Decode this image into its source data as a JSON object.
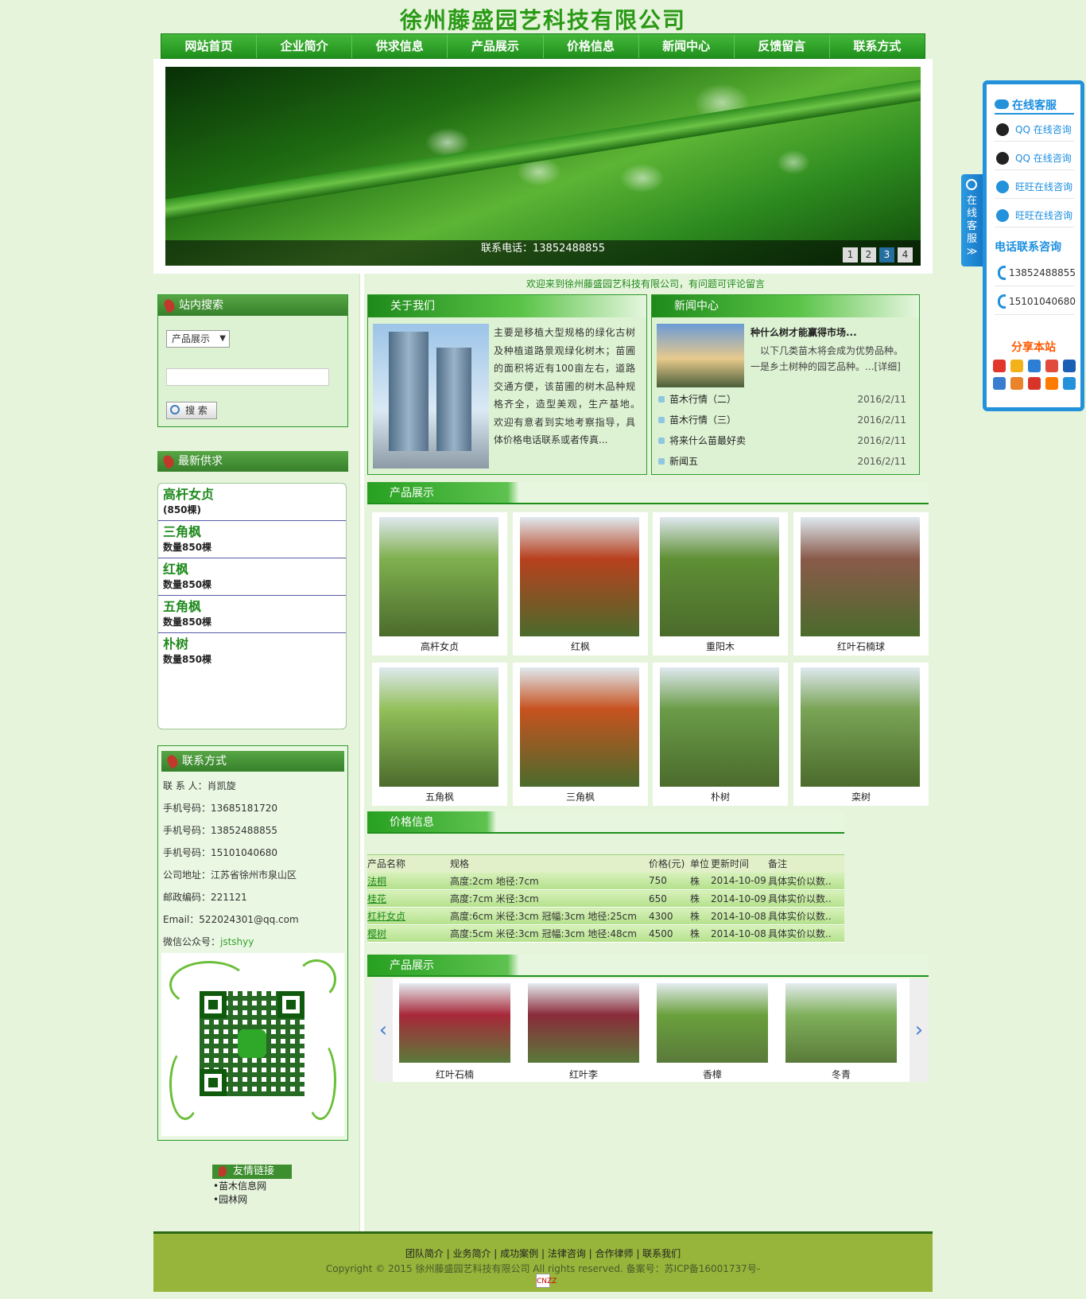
{
  "site": {
    "title": "徐州藤盛园艺科技有限公司"
  },
  "nav": [
    "网站首页",
    "企业简介",
    "供求信息",
    "产品展示",
    "价格信息",
    "新闻中心",
    "反馈留言",
    "联系方式"
  ],
  "banner": {
    "phone": "联系电话：13852488855",
    "dots": [
      "1",
      "2",
      "3",
      "4"
    ],
    "active_dot": 3
  },
  "search": {
    "title": "站内搜索",
    "select_value": "产品展示",
    "button": "搜 索"
  },
  "supply": {
    "title": "最新供求",
    "items": [
      {
        "name": "高杆女贞",
        "qty": "(850棵)"
      },
      {
        "name": "三角枫",
        "qty": "数量850棵"
      },
      {
        "name": "红枫",
        "qty": "数量850棵"
      },
      {
        "name": "五角枫",
        "qty": "数量850棵"
      },
      {
        "name": "朴树",
        "qty": "数量850棵"
      }
    ]
  },
  "contact": {
    "title": "联系方式",
    "rows": [
      "联 系 人：肖凯旋",
      "手机号码：13685181720",
      "手机号码：13852488855",
      "手机号码：15101040680",
      "公司地址：江苏省徐州市泉山区",
      "邮政编码：221121",
      "Email：522024301@qq.com"
    ],
    "wechat_label": "微信公众号：",
    "wechat_id": "jstshyy"
  },
  "links": {
    "title": "友情链接",
    "items": [
      "苗木信息网",
      "园林网"
    ]
  },
  "welcome": "欢迎来到徐州藤盛园艺科技有限公司，有问题可评论留言",
  "about": {
    "title": "关于我们",
    "text": "主要是移植大型规格的绿化古树及种植道路景观绿化树木；苗圃的面积将近有100亩左右，道路交通方便，该苗圃的树木品种规格齐全，造型美观，生产基地。　欢迎有意者到实地考察指导，具体价格电话联系或者传真..."
  },
  "news": {
    "title": "新闻中心",
    "headline": "种什么树才能赢得市场...",
    "desc": "以下几类苗木将会成为优势品种。一是乡土树种的园艺品种。...[详细]",
    "rows": [
      {
        "title": "苗木行情（二）",
        "date": "2016/2/11"
      },
      {
        "title": "苗木行情（三）",
        "date": "2016/2/11"
      },
      {
        "title": "将来什么苗最好卖",
        "date": "2016/2/11"
      },
      {
        "title": "新闻五",
        "date": "2016/2/11"
      }
    ]
  },
  "products": {
    "title": "产品展示",
    "items": [
      "高杆女贞",
      "红枫",
      "重阳木",
      "红叶石楠球",
      "五角枫",
      "三角枫",
      "朴树",
      "栾树"
    ],
    "colors": [
      "#7fb04e",
      "#b8401e",
      "#5f8f35",
      "#8a5a4a",
      "#92c05a",
      "#c7521f",
      "#6a9c48",
      "#7aa456"
    ]
  },
  "prices": {
    "title": "价格信息",
    "headers": [
      "产品名称",
      "规格",
      "价格(元)",
      "单位",
      "更新时间",
      "备注"
    ],
    "rows": [
      [
        "法桐",
        "高度:2cm 地径:7cm",
        "750",
        "株",
        "2014-10-09",
        "具体实价以数.."
      ],
      [
        "桂花",
        "高度:7cm 米径:3cm",
        "650",
        "株",
        "2014-10-09",
        "具体实价以数.."
      ],
      [
        "杠杆女贞",
        "高度:6cm 米径:3cm 冠幅:3cm 地径:25cm",
        "4300",
        "株",
        "2014-10-08",
        "具体实价以数.."
      ],
      [
        "樱树",
        "高度:5cm 米径:3cm 冠幅:3cm 地径:48cm",
        "4500",
        "株",
        "2014-10-08",
        "具体实价以数.."
      ]
    ]
  },
  "carousel": {
    "title": "产品展示",
    "items": [
      "红叶石楠",
      "红叶李",
      "香樟",
      "冬青"
    ],
    "colors": [
      "#a8283a",
      "#8a2b3a",
      "#6aa03d",
      "#7fb05a"
    ]
  },
  "footer": {
    "links": "团队简介 | 业务简介 | 成功案例 | 法律咨询 | 合作律师 | 联系我们",
    "copyright": "Copyright © 2015 徐州藤盛园艺科技有限公司 All rights reserved. 备案号：苏ICP备16001737号-",
    "stat": "CNZZ"
  },
  "service": {
    "tab": "在线客服",
    "tab_arrow": "≫",
    "title": "在线客服",
    "qq": [
      "QQ 在线咨询",
      "QQ 在线咨询"
    ],
    "wangwang": [
      "旺旺在线咨询",
      "旺旺在线咨询"
    ],
    "phone_title": "电话联系咨询",
    "phones": [
      "13852488855",
      "15101040680"
    ],
    "share_title": "分享本站"
  }
}
